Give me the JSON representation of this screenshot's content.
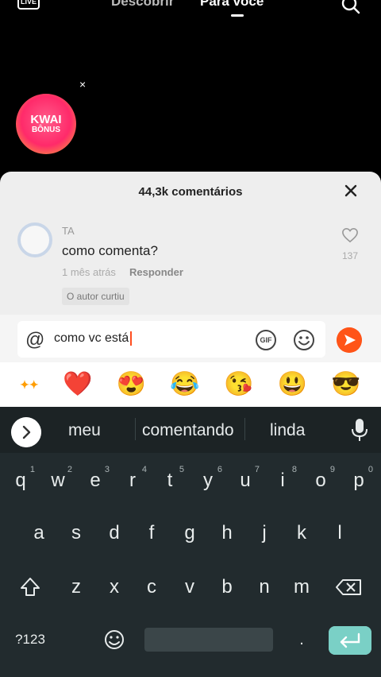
{
  "topbar": {
    "live_label": "LIVE",
    "discover_label": "Descobrir",
    "for_you_label": "Para você"
  },
  "bonus": {
    "line1": "KWAI",
    "line2": "BÔNUS",
    "close": "×"
  },
  "comments": {
    "title": "44,3k comentários",
    "items": [
      {
        "author": "TA",
        "text": "como comenta?",
        "time": "1 mês atrás",
        "reply_label": "Responder",
        "badge": "O autor curtiu",
        "likes": "137"
      }
    ]
  },
  "input": {
    "at": "@",
    "value": "como vc está",
    "gif_label": "GIF"
  },
  "emoji_row": [
    "kwai",
    "❤️",
    "😍",
    "😂",
    "😘",
    "😃",
    "😎"
  ],
  "keyboard": {
    "suggestions": [
      "meu",
      "comentando",
      "linda"
    ],
    "row1": [
      [
        "q",
        "1"
      ],
      [
        "w",
        "2"
      ],
      [
        "e",
        "3"
      ],
      [
        "r",
        "4"
      ],
      [
        "t",
        "5"
      ],
      [
        "y",
        "6"
      ],
      [
        "u",
        "7"
      ],
      [
        "i",
        "8"
      ],
      [
        "o",
        "9"
      ],
      [
        "p",
        "0"
      ]
    ],
    "row2": [
      "a",
      "s",
      "d",
      "f",
      "g",
      "h",
      "j",
      "k",
      "l"
    ],
    "row3": [
      "z",
      "x",
      "c",
      "v",
      "b",
      "n",
      "m"
    ],
    "symbols_label": "?123"
  },
  "colors": {
    "accent": "#ff5418",
    "enter_key": "#7ad0c6",
    "keyboard_bg": "#222b2e"
  }
}
